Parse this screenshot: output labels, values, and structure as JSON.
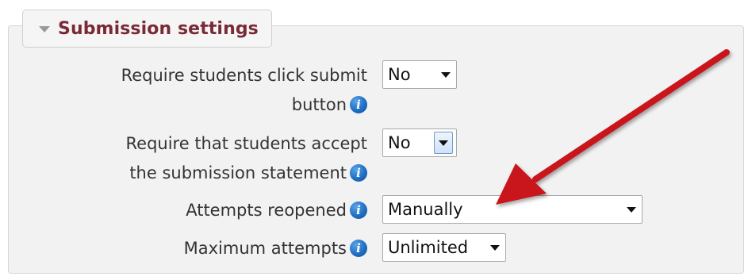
{
  "section": {
    "title": "Submission settings"
  },
  "fields": [
    {
      "label_line1": "Require students click submit",
      "label_line2": "button",
      "value": "No"
    },
    {
      "label_line1": "Require that students accept",
      "label_line2": "the submission statement",
      "value": "No"
    },
    {
      "label_line1": "Attempts reopened",
      "value": "Manually"
    },
    {
      "label_line1": "Maximum attempts",
      "value": "Unlimited"
    }
  ],
  "icons": {
    "info_glyph": "i",
    "help": "info-icon",
    "collapse": "triangle-down-icon",
    "dropdown": "chevron-down-icon",
    "annotation": "red-arrow"
  },
  "colors": {
    "section_title": "#7a2a36",
    "fieldset_background": "#f2f2f2",
    "info_icon": "#1f6fc4",
    "annotation_arrow": "#c8181e"
  }
}
